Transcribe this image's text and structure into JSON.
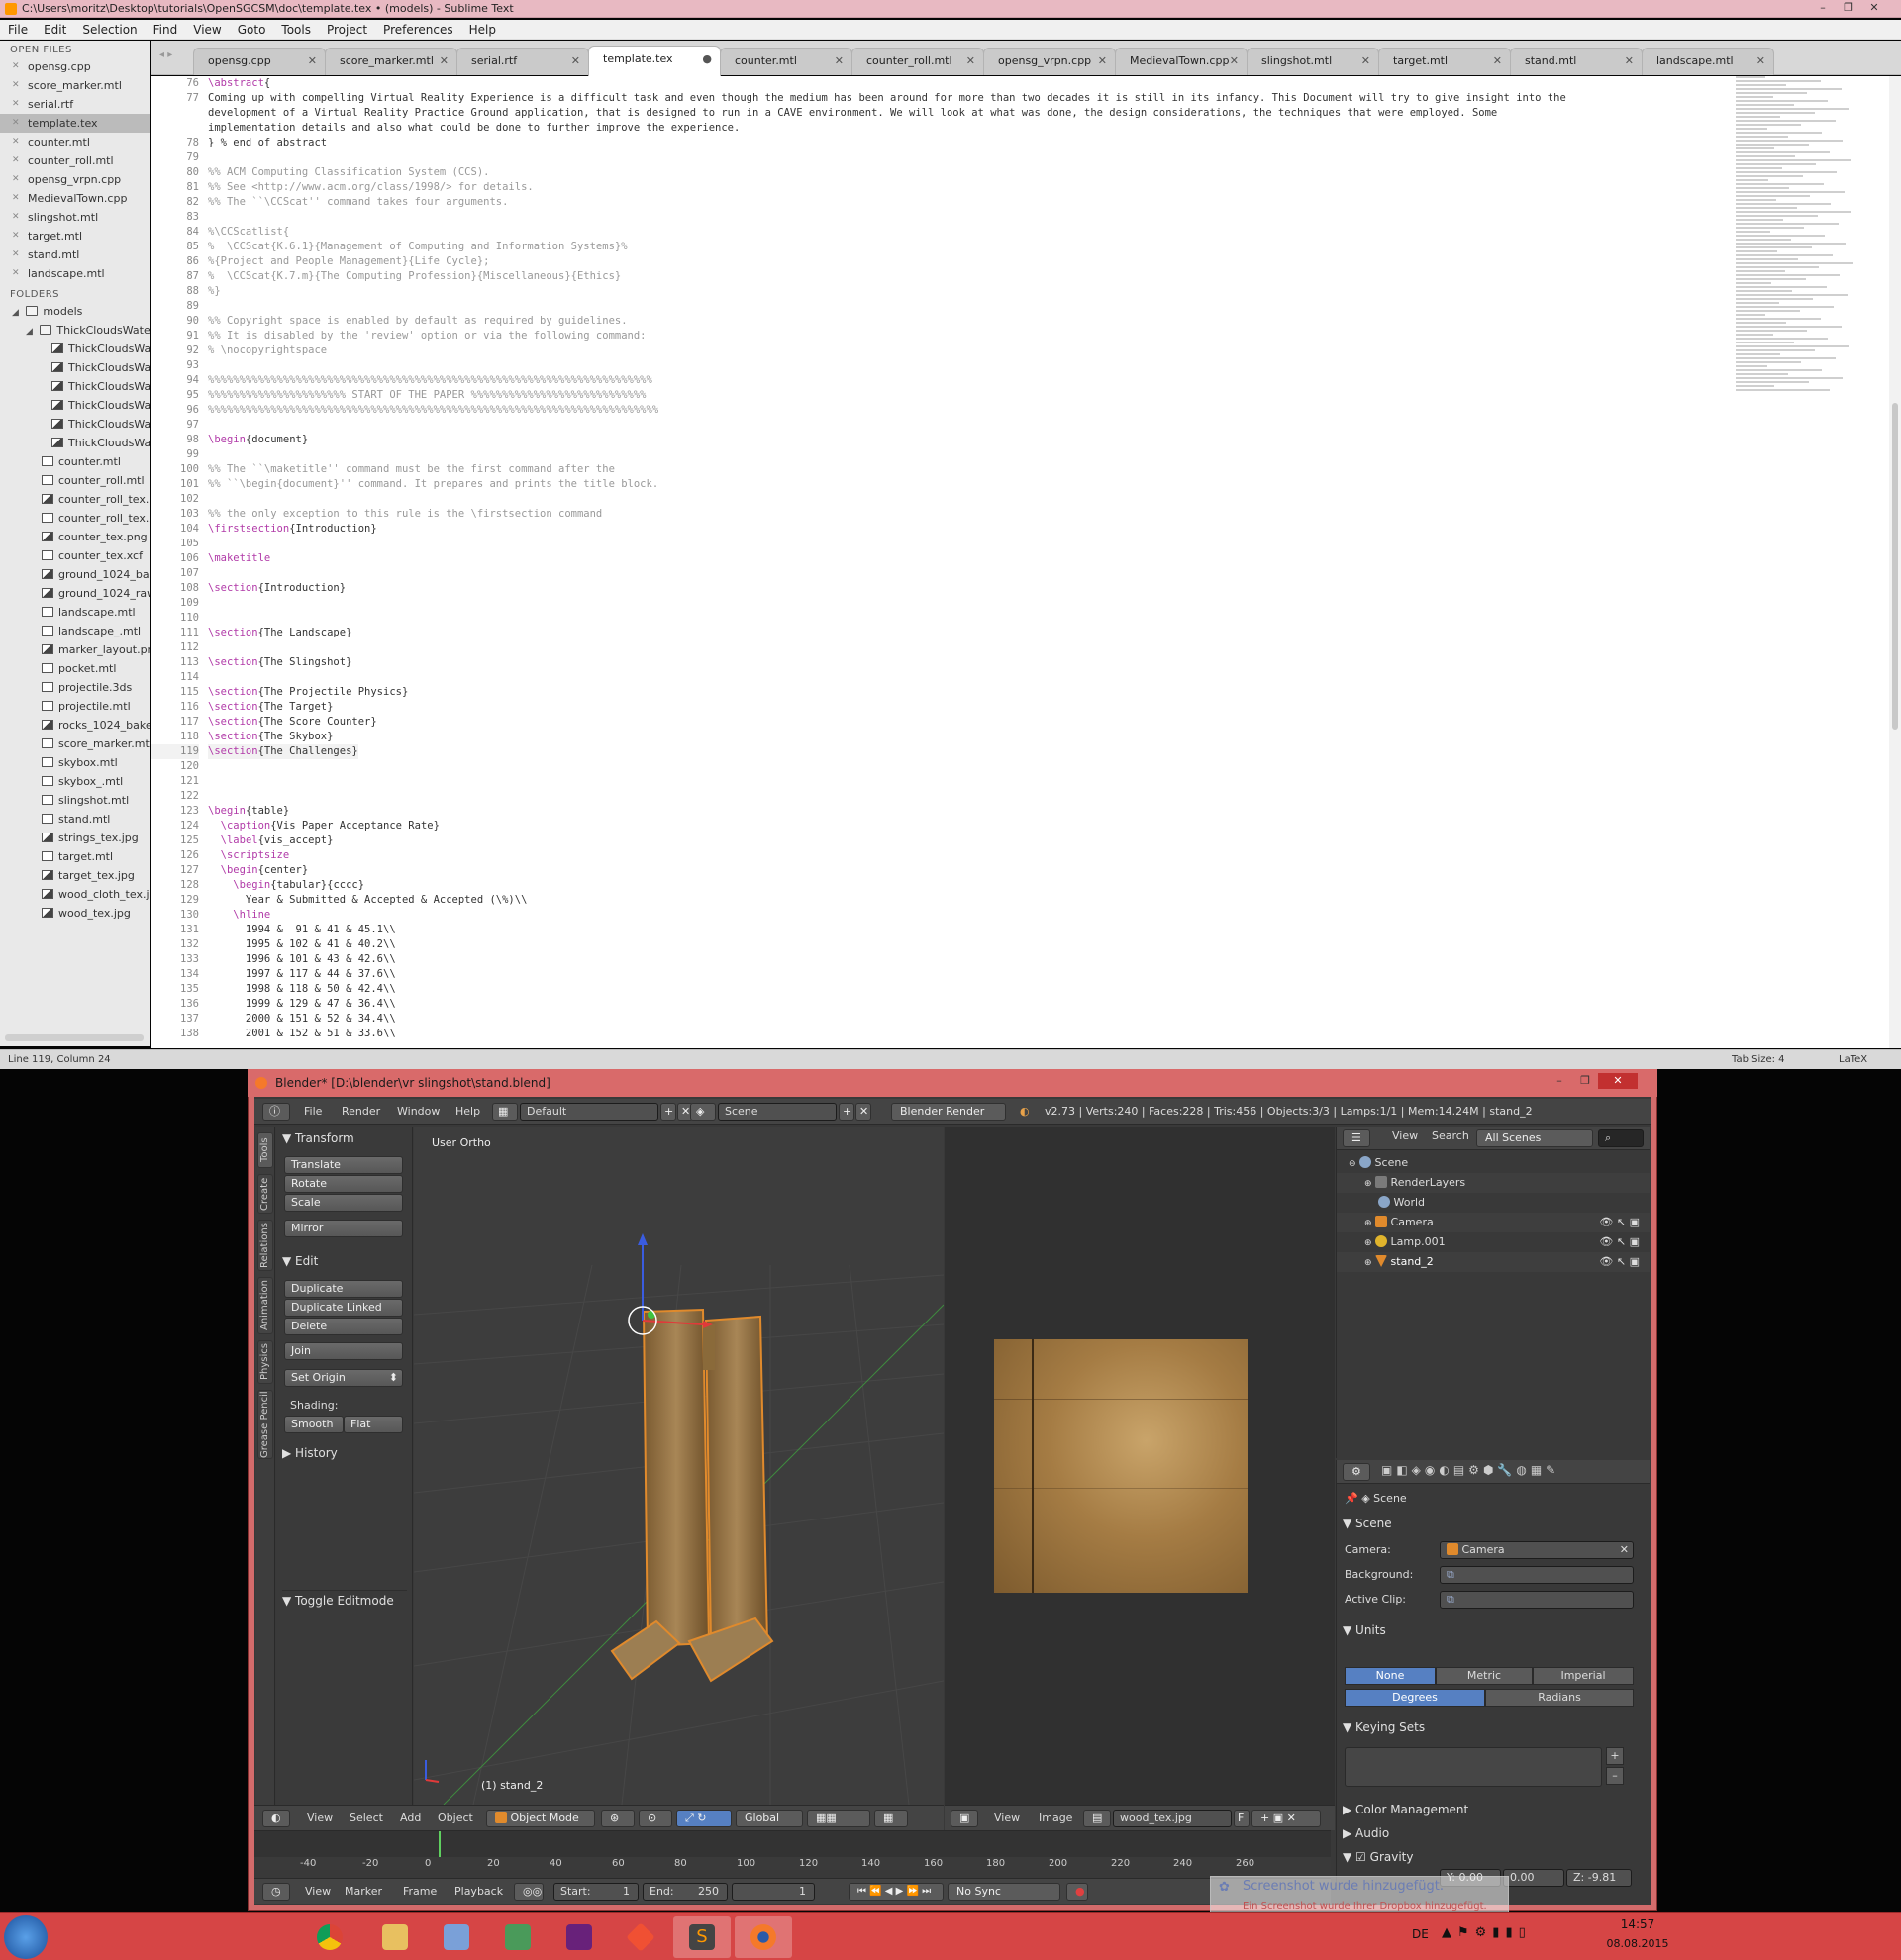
{
  "sublime": {
    "title": "C:\\Users\\moritz\\Desktop\\tutorials\\OpenSGCSM\\doc\\template.tex • (models) - Sublime Text",
    "menu": [
      "File",
      "Edit",
      "Selection",
      "Find",
      "View",
      "Goto",
      "Tools",
      "Project",
      "Preferences",
      "Help"
    ],
    "open_files_header": "OPEN FILES",
    "open_files": [
      "opensg.cpp",
      "score_marker.mtl",
      "serial.rtf",
      "template.tex",
      "counter.mtl",
      "counter_roll.mtl",
      "opensg_vrpn.cpp",
      "MedievalTown.cpp",
      "slingshot.mtl",
      "target.mtl",
      "stand.mtl",
      "landscape.mtl"
    ],
    "folders_header": "FOLDERS",
    "folder_root": "models",
    "subfolder": "ThickCloudsWater",
    "subfolder_files": [
      "ThickCloudsWa",
      "ThickCloudsWa",
      "ThickCloudsWa",
      "ThickCloudsWa",
      "ThickCloudsWa",
      "ThickCloudsWa"
    ],
    "folder_files": [
      {
        "name": "counter.mtl",
        "img": false
      },
      {
        "name": "counter_roll.mtl",
        "img": false
      },
      {
        "name": "counter_roll_tex.p",
        "img": true
      },
      {
        "name": "counter_roll_tex.x",
        "img": false
      },
      {
        "name": "counter_tex.png",
        "img": true
      },
      {
        "name": "counter_tex.xcf",
        "img": false
      },
      {
        "name": "ground_1024_bak",
        "img": true
      },
      {
        "name": "ground_1024_raw",
        "img": true
      },
      {
        "name": "landscape.mtl",
        "img": false
      },
      {
        "name": "landscape_.mtl",
        "img": false
      },
      {
        "name": "marker_layout.png",
        "img": true
      },
      {
        "name": "pocket.mtl",
        "img": false
      },
      {
        "name": "projectile.3ds",
        "img": false
      },
      {
        "name": "projectile.mtl",
        "img": false
      },
      {
        "name": "rocks_1024_baked",
        "img": true
      },
      {
        "name": "score_marker.mtl",
        "img": false
      },
      {
        "name": "skybox.mtl",
        "img": false
      },
      {
        "name": "skybox_.mtl",
        "img": false
      },
      {
        "name": "slingshot.mtl",
        "img": false
      },
      {
        "name": "stand.mtl",
        "img": false
      },
      {
        "name": "strings_tex.jpg",
        "img": true
      },
      {
        "name": "target.mtl",
        "img": false
      },
      {
        "name": "target_tex.jpg",
        "img": true
      },
      {
        "name": "wood_cloth_tex.jp",
        "img": true
      },
      {
        "name": "wood_tex.jpg",
        "img": true
      }
    ],
    "tabs": [
      "opensg.cpp",
      "score_marker.mtl",
      "serial.rtf",
      "template.tex",
      "counter.mtl",
      "counter_roll.mtl",
      "opensg_vrpn.cpp",
      "MedievalTown.cpp",
      "slingshot.mtl",
      "target.mtl",
      "stand.mtl",
      "landscape.mtl"
    ],
    "active_tab": "template.tex",
    "code_lines": [
      {
        "n": "76",
        "t": "\\abstract{"
      },
      {
        "n": "77",
        "t": "Coming up with compelling Virtual Reality Experience is a difficult task and even though the medium has been around for more than two decades it is still in its infancy. This Document will try to give insight into the"
      },
      {
        "n": "",
        "t": "development of a Virtual Reality Practice Ground application, that is designed to run in a CAVE environment. We will look at what was done, the design considerations, the techniques that were employed. Some"
      },
      {
        "n": "",
        "t": "implementation details and also what could be done to further improve the experience."
      },
      {
        "n": "78",
        "t": "} % end of abstract"
      },
      {
        "n": "79",
        "t": ""
      },
      {
        "n": "80",
        "t": "%% ACM Computing Classification System (CCS)."
      },
      {
        "n": "81",
        "t": "%% See <http://www.acm.org/class/1998/> for details."
      },
      {
        "n": "82",
        "t": "%% The ``\\CCScat'' command takes four arguments."
      },
      {
        "n": "83",
        "t": ""
      },
      {
        "n": "84",
        "t": "%\\CCScatlist{"
      },
      {
        "n": "85",
        "t": "%  \\CCScat{K.6.1}{Management of Computing and Information Systems}%"
      },
      {
        "n": "86",
        "t": "%{Project and People Management}{Life Cycle};"
      },
      {
        "n": "87",
        "t": "%  \\CCScat{K.7.m}{The Computing Profession}{Miscellaneous}{Ethics}"
      },
      {
        "n": "88",
        "t": "%}"
      },
      {
        "n": "89",
        "t": ""
      },
      {
        "n": "90",
        "t": "%% Copyright space is enabled by default as required by guidelines."
      },
      {
        "n": "91",
        "t": "%% It is disabled by the 'review' option or via the following command:"
      },
      {
        "n": "92",
        "t": "% \\nocopyrightspace"
      },
      {
        "n": "93",
        "t": ""
      },
      {
        "n": "94",
        "t": "%%%%%%%%%%%%%%%%%%%%%%%%%%%%%%%%%%%%%%%%%%%%%%%%%%%%%%%%%%%%%%%%%%%%%%%"
      },
      {
        "n": "95",
        "t": "%%%%%%%%%%%%%%%%%%%%%% START OF THE PAPER %%%%%%%%%%%%%%%%%%%%%%%%%%%%"
      },
      {
        "n": "96",
        "t": "%%%%%%%%%%%%%%%%%%%%%%%%%%%%%%%%%%%%%%%%%%%%%%%%%%%%%%%%%%%%%%%%%%%%%%%%"
      },
      {
        "n": "97",
        "t": ""
      },
      {
        "n": "98",
        "t": "\\begin{document}"
      },
      {
        "n": "99",
        "t": ""
      },
      {
        "n": "100",
        "t": "%% The ``\\maketitle'' command must be the first command after the"
      },
      {
        "n": "101",
        "t": "%% ``\\begin{document}'' command. It prepares and prints the title block."
      },
      {
        "n": "102",
        "t": ""
      },
      {
        "n": "103",
        "t": "%% the only exception to this rule is the \\firstsection command"
      },
      {
        "n": "104",
        "t": "\\firstsection{Introduction}"
      },
      {
        "n": "105",
        "t": ""
      },
      {
        "n": "106",
        "t": "\\maketitle"
      },
      {
        "n": "107",
        "t": ""
      },
      {
        "n": "108",
        "t": "\\section{Introduction}"
      },
      {
        "n": "109",
        "t": ""
      },
      {
        "n": "110",
        "t": ""
      },
      {
        "n": "111",
        "t": "\\section{The Landscape}"
      },
      {
        "n": "112",
        "t": ""
      },
      {
        "n": "113",
        "t": "\\section{The Slingshot}"
      },
      {
        "n": "114",
        "t": ""
      },
      {
        "n": "115",
        "t": "\\section{The Projectile Physics}"
      },
      {
        "n": "116",
        "t": "\\section{The Target}"
      },
      {
        "n": "117",
        "t": "\\section{The Score Counter}"
      },
      {
        "n": "118",
        "t": "\\section{The Skybox}"
      },
      {
        "n": "119",
        "t": "\\section{The Challenges}"
      },
      {
        "n": "120",
        "t": ""
      },
      {
        "n": "121",
        "t": ""
      },
      {
        "n": "122",
        "t": ""
      },
      {
        "n": "123",
        "t": "\\begin{table}"
      },
      {
        "n": "124",
        "t": "  \\caption{Vis Paper Acceptance Rate}"
      },
      {
        "n": "125",
        "t": "  \\label{vis_accept}"
      },
      {
        "n": "126",
        "t": "  \\scriptsize"
      },
      {
        "n": "127",
        "t": "  \\begin{center}"
      },
      {
        "n": "128",
        "t": "    \\begin{tabular}{cccc}"
      },
      {
        "n": "129",
        "t": "      Year & Submitted & Accepted & Accepted (\\%)\\\\"
      },
      {
        "n": "130",
        "t": "    \\hline"
      },
      {
        "n": "131",
        "t": "      1994 &  91 & 41 & 45.1\\\\"
      },
      {
        "n": "132",
        "t": "      1995 & 102 & 41 & 40.2\\\\"
      },
      {
        "n": "133",
        "t": "      1996 & 101 & 43 & 42.6\\\\"
      },
      {
        "n": "134",
        "t": "      1997 & 117 & 44 & 37.6\\\\"
      },
      {
        "n": "135",
        "t": "      1998 & 118 & 50 & 42.4\\\\"
      },
      {
        "n": "136",
        "t": "      1999 & 129 & 47 & 36.4\\\\"
      },
      {
        "n": "137",
        "t": "      2000 & 151 & 52 & 34.4\\\\"
      },
      {
        "n": "138",
        "t": "      2001 & 152 & 51 & 33.6\\\\"
      }
    ],
    "status_left": "Line 119, Column 24",
    "status_tabsize": "Tab Size: 4",
    "status_syntax": "LaTeX"
  },
  "blender": {
    "title": "Blender* [D:\\blender\\vr slingshot\\stand.blend]",
    "menu": [
      "File",
      "Render",
      "Window",
      "Help"
    ],
    "layout": "Default",
    "scene": "Scene",
    "engine": "Blender Render",
    "stats": "v2.73 | Verts:240 | Faces:228 | Tris:456 | Objects:3/3 | Lamps:1/1 | Mem:14.24M | stand_2",
    "vtabs": [
      "Tools",
      "Create",
      "Relations",
      "Animation",
      "Physics",
      "Grease Pencil"
    ],
    "transform_header": "Transform",
    "transform_btns": [
      "Translate",
      "Rotate",
      "Scale",
      "Mirror"
    ],
    "edit_header": "Edit",
    "edit_btns": [
      "Duplicate",
      "Duplicate Linked",
      "Delete",
      "Join",
      "Set Origin"
    ],
    "shading_label": "Shading:",
    "shading_smooth": "Smooth",
    "shading_flat": "Flat",
    "history_header": "History",
    "toggle_editmode": "Toggle Editmode",
    "viewport_label": "User Ortho",
    "selected_label": "(1) stand_2",
    "outliner_menu": [
      "View",
      "Search"
    ],
    "outliner_filter": "All Scenes",
    "outliner_items": [
      "Scene",
      "RenderLayers",
      "World",
      "Camera",
      "Lamp.001",
      "stand_2"
    ],
    "props_breadcrumb": "Scene",
    "scene_panel": "Scene",
    "camera_label": "Camera:",
    "camera_value": "Camera",
    "background_label": "Background:",
    "active_clip_label": "Active Clip:",
    "units_panel": "Units",
    "units_system": [
      "None",
      "Metric",
      "Imperial"
    ],
    "units_rotation": [
      "Degrees",
      "Radians"
    ],
    "keying_sets_panel": "Keying Sets",
    "color_mgmt_panel": "Color Management",
    "audio_panel": "Audio",
    "gravity_panel": "Gravity",
    "gravity_y": "0.00",
    "gravity_y_label": "Y:",
    "gravity_x": "0.00",
    "gravity_z_label": "Z:",
    "gravity_z": "-9.81",
    "v3d_menu": [
      "View",
      "Select",
      "Add",
      "Object"
    ],
    "mode": "Object Mode",
    "orientation": "Global",
    "img_menu": [
      "View",
      "Image"
    ],
    "image_name": "wood_tex.jpg",
    "image_f": "F",
    "timeline_ticks": [
      "-40",
      "-20",
      "0",
      "20",
      "40",
      "60",
      "80",
      "100",
      "120",
      "140",
      "160",
      "180",
      "200",
      "220",
      "240",
      "260"
    ],
    "timeline_menu": [
      "View",
      "Marker",
      "Frame",
      "Playback"
    ],
    "start_label": "Start:",
    "start_value": "1",
    "end_label": "End:",
    "end_value": "250",
    "current_frame": "1",
    "sync": "No Sync"
  },
  "toast": {
    "title": "Screenshot wurde hinzugefügt.",
    "body": "Ein Screenshot wurde Ihrer Dropbox hinzugefügt."
  },
  "taskbar": {
    "lang": "DE",
    "time": "14:57",
    "date": "08.08.2015"
  }
}
